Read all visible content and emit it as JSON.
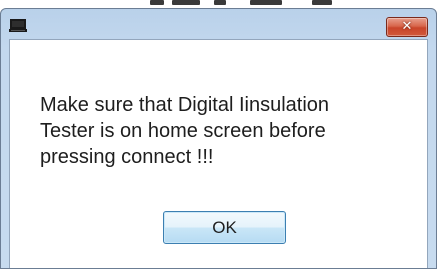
{
  "dialog": {
    "close_glyph": "✕",
    "app_icon": "computer-icon",
    "message_lines": [
      "Make sure that Digital Iinsulation",
      "Tester is on home screen before",
      "pressing connect !!!"
    ],
    "ok_label": "OK"
  },
  "colors": {
    "frame": "#c3d8ee",
    "close_button": "#c9452a",
    "ok_button_border": "#3c7fb1"
  }
}
